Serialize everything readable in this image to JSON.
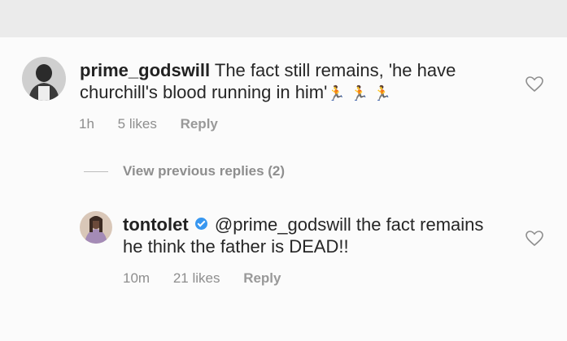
{
  "comment": {
    "username": "prime_godswill",
    "text": "The fact still remains, 'he have churchill's blood running in him'",
    "emoji": "🏃 🏃 🏃",
    "time": "1h",
    "likes": "5 likes",
    "reply_label": "Reply"
  },
  "view_replies_label": "View previous replies (2)",
  "reply": {
    "username": "tontolet",
    "mention": "@prime_godswill",
    "text": "the fact remains he think the father is DEAD!!",
    "time": "10m",
    "likes": "21 likes",
    "reply_label": "Reply"
  },
  "colors": {
    "verified": "#3897f0",
    "text": "#262626",
    "meta": "#8e8e8e"
  }
}
